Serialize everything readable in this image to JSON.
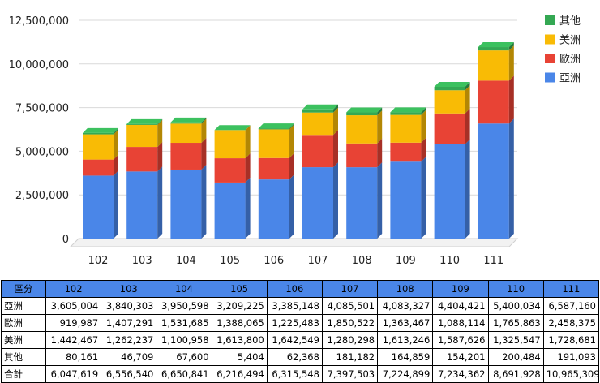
{
  "chart_data": {
    "type": "bar",
    "stacked": true,
    "style": "3d",
    "categories": [
      "102",
      "103",
      "104",
      "105",
      "106",
      "107",
      "108",
      "109",
      "110",
      "111"
    ],
    "series": [
      {
        "name": "亞洲",
        "color": "#4a86e8",
        "values": [
          3605004,
          3840303,
          3950598,
          3209225,
          3385148,
          4085501,
          4083327,
          4404421,
          5400034,
          6587160
        ]
      },
      {
        "name": "歐洲",
        "color": "#e84335",
        "values": [
          919987,
          1407291,
          1531685,
          1388065,
          1225483,
          1850522,
          1363467,
          1088114,
          1765863,
          2458375
        ]
      },
      {
        "name": "美洲",
        "color": "#f9bb05",
        "values": [
          1442467,
          1262237,
          1100958,
          1613800,
          1642549,
          1280298,
          1613246,
          1587626,
          1325547,
          1728681
        ]
      },
      {
        "name": "其他",
        "color": "#34a853",
        "values": [
          80161,
          46709,
          67600,
          5404,
          62368,
          181182,
          164859,
          154201,
          200484,
          191093
        ]
      }
    ],
    "y_ticks": [
      "0",
      "2,500,000",
      "5,000,000",
      "7,500,000",
      "10,000,000",
      "12,500,000"
    ],
    "ylim": [
      0,
      12500000
    ],
    "grid": true,
    "legend_position": "right"
  },
  "table": {
    "header": [
      "區分",
      "102",
      "103",
      "104",
      "105",
      "106",
      "107",
      "108",
      "109",
      "110",
      "111"
    ],
    "rows": [
      [
        "亞洲",
        "3,605,004",
        "3,840,303",
        "3,950,598",
        "3,209,225",
        "3,385,148",
        "4,085,501",
        "4,083,327",
        "4,404,421",
        "5,400,034",
        "6,587,160"
      ],
      [
        "歐洲",
        "919,987",
        "1,407,291",
        "1,531,685",
        "1,388,065",
        "1,225,483",
        "1,850,522",
        "1,363,467",
        "1,088,114",
        "1,765,863",
        "2,458,375"
      ],
      [
        "美洲",
        "1,442,467",
        "1,262,237",
        "1,100,958",
        "1,613,800",
        "1,642,549",
        "1,280,298",
        "1,613,246",
        "1,587,626",
        "1,325,547",
        "1,728,681"
      ],
      [
        "其他",
        "80,161",
        "46,709",
        "67,600",
        "5,404",
        "62,368",
        "181,182",
        "164,859",
        "154,201",
        "200,484",
        "191,093"
      ],
      [
        "合計",
        "6,047,619",
        "6,556,540",
        "6,650,841",
        "6,216,494",
        "6,315,548",
        "7,397,503",
        "7,224,899",
        "7,234,362",
        "8,691,928",
        "10,965,309"
      ]
    ]
  }
}
